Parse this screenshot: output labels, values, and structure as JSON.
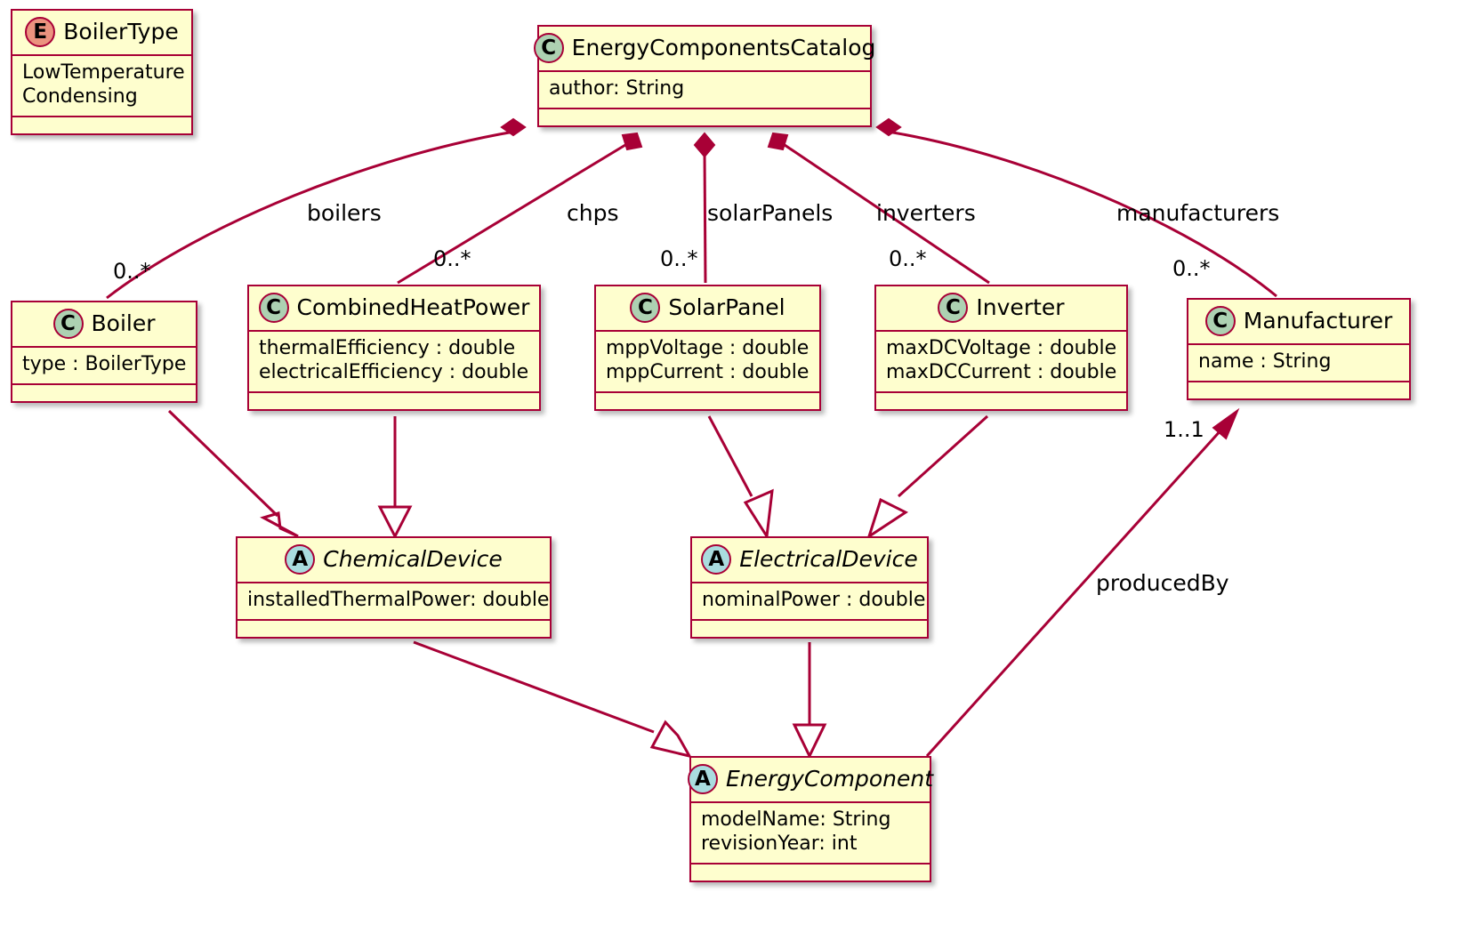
{
  "diagram": {
    "type": "uml-class-diagram",
    "colors": {
      "border": "#A80036",
      "fill": "#FEFECE",
      "class_icon": "#ADD1B2",
      "abstract_icon": "#A9DCDF",
      "enum_icon": "#EB937F",
      "line": "#A80036",
      "text": "#000000"
    }
  },
  "classes": {
    "boiler_type": {
      "stereotype": "E",
      "name": "BoilerType",
      "kind": "enum",
      "values": [
        "LowTemperature",
        "Condensing"
      ]
    },
    "catalog": {
      "stereotype": "C",
      "name": "EnergyComponentsCatalog",
      "kind": "class",
      "attributes": [
        "author: String"
      ]
    },
    "boiler": {
      "stereotype": "C",
      "name": "Boiler",
      "kind": "class",
      "attributes": [
        "type : BoilerType"
      ]
    },
    "chp": {
      "stereotype": "C",
      "name": "CombinedHeatPower",
      "kind": "class",
      "attributes": [
        "thermalEfficiency : double",
        "electricalEfficiency : double"
      ]
    },
    "solar_panel": {
      "stereotype": "C",
      "name": "SolarPanel",
      "kind": "class",
      "attributes": [
        "mppVoltage : double",
        "mppCurrent : double"
      ]
    },
    "inverter": {
      "stereotype": "C",
      "name": "Inverter",
      "kind": "class",
      "attributes": [
        "maxDCVoltage : double",
        "maxDCCurrent : double"
      ]
    },
    "manufacturer": {
      "stereotype": "C",
      "name": "Manufacturer",
      "kind": "class",
      "attributes": [
        "name : String"
      ]
    },
    "chemical_device": {
      "stereotype": "A",
      "name": "ChemicalDevice",
      "kind": "abstract",
      "attributes": [
        "installedThermalPower: double"
      ]
    },
    "electrical_device": {
      "stereotype": "A",
      "name": "ElectricalDevice",
      "kind": "abstract",
      "attributes": [
        "nominalPower : double"
      ]
    },
    "energy_component": {
      "stereotype": "A",
      "name": "EnergyComponent",
      "kind": "abstract",
      "attributes": [
        "modelName: String",
        "revisionYear: int"
      ]
    }
  },
  "relationships": {
    "boilers": {
      "label": "boilers",
      "multiplicity": "0..*",
      "kind": "composition",
      "from": "EnergyComponentsCatalog",
      "to": "Boiler"
    },
    "chps": {
      "label": "chps",
      "multiplicity": "0..*",
      "kind": "composition",
      "from": "EnergyComponentsCatalog",
      "to": "CombinedHeatPower"
    },
    "solar_panels": {
      "label": "solarPanels",
      "multiplicity": "0..*",
      "kind": "composition",
      "from": "EnergyComponentsCatalog",
      "to": "SolarPanel"
    },
    "inverters": {
      "label": "inverters",
      "multiplicity": "0..*",
      "kind": "composition",
      "from": "EnergyComponentsCatalog",
      "to": "Inverter"
    },
    "manufacturers": {
      "label": "manufacturers",
      "multiplicity": "0..*",
      "kind": "composition",
      "from": "EnergyComponentsCatalog",
      "to": "Manufacturer"
    },
    "produced_by": {
      "label": "producedBy",
      "multiplicity": "1..1",
      "kind": "association",
      "from": "EnergyComponent",
      "to": "Manufacturer"
    },
    "boiler_inherits": {
      "label": "",
      "kind": "generalization",
      "from": "Boiler",
      "to": "ChemicalDevice"
    },
    "chp_inherits": {
      "label": "",
      "kind": "generalization",
      "from": "CombinedHeatPower",
      "to": "ChemicalDevice"
    },
    "solar_inherits": {
      "label": "",
      "kind": "generalization",
      "from": "SolarPanel",
      "to": "ElectricalDevice"
    },
    "inverter_inherits": {
      "label": "",
      "kind": "generalization",
      "from": "Inverter",
      "to": "ElectricalDevice"
    },
    "chemical_inherits": {
      "label": "",
      "kind": "generalization",
      "from": "ChemicalDevice",
      "to": "EnergyComponent"
    },
    "electrical_inherits": {
      "label": "",
      "kind": "generalization",
      "from": "ElectricalDevice",
      "to": "EnergyComponent"
    }
  }
}
